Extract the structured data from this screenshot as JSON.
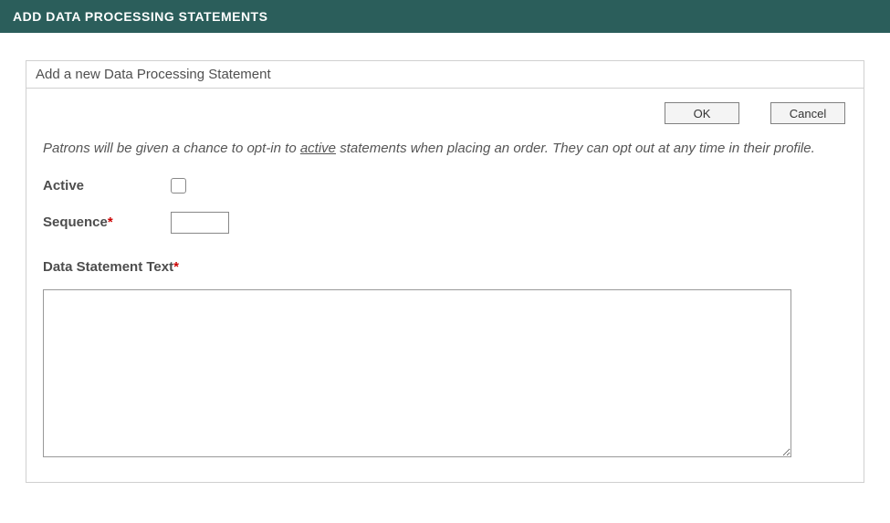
{
  "header": {
    "title": "ADD DATA PROCESSING STATEMENTS"
  },
  "panel": {
    "title": "Add a new Data Processing Statement"
  },
  "buttons": {
    "ok": "OK",
    "cancel": "Cancel"
  },
  "hint": {
    "pre": "Patrons will be given a chance to opt-in to ",
    "underlined": "active",
    "post": " statements when placing an order. They can opt out at any time in their profile."
  },
  "fields": {
    "active_label": "Active",
    "sequence_label": "Sequence",
    "sequence_value": "",
    "statement_label": "Data Statement Text",
    "statement_value": ""
  }
}
